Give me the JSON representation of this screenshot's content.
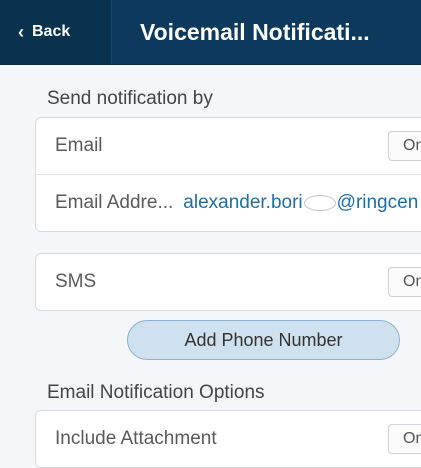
{
  "header": {
    "back_label": "Back",
    "title": "Voicemail Notificati..."
  },
  "send_section": {
    "label": "Send notification by"
  },
  "email_card": {
    "email_label": "Email",
    "email_toggle": "On",
    "address_label": "Email Addre...",
    "address_value_start": "alexander.bori",
    "address_value_end": "@ringcen"
  },
  "sms_card": {
    "sms_label": "SMS",
    "sms_toggle": "On"
  },
  "add_phone_button": "Add Phone Number",
  "options_section": {
    "label": "Email Notification Options"
  },
  "options_card": {
    "attachment_label": "Include Attachment",
    "attachment_toggle": "On"
  }
}
